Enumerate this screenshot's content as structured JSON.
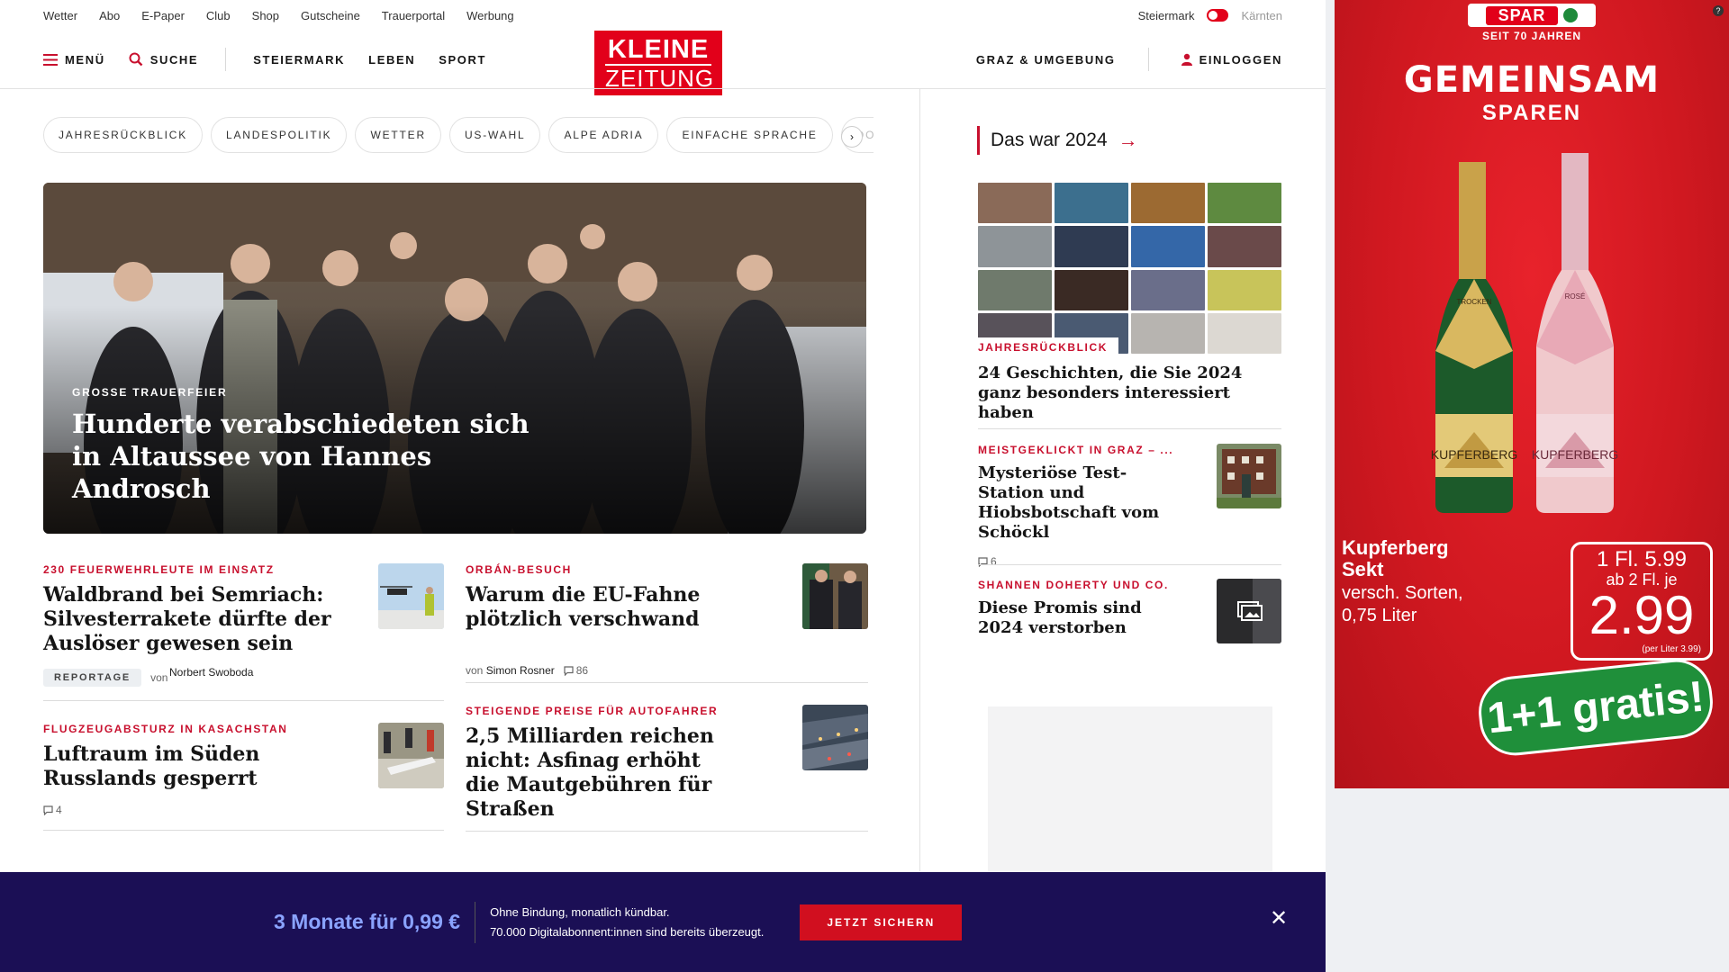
{
  "utility": {
    "links": [
      "Wetter",
      "Abo",
      "E-Paper",
      "Club",
      "Shop",
      "Gutscheine",
      "Trauerportal",
      "Werbung"
    ],
    "region_active": "Steiermark",
    "region_other": "Kärnten"
  },
  "nav": {
    "menu": "MENÜ",
    "search": "SUCHE",
    "sections": [
      "STEIERMARK",
      "LEBEN",
      "SPORT"
    ],
    "local": "GRAZ & UMGEBUNG",
    "login": "EINLOGGEN",
    "logo_line1": "KLEINE",
    "logo_line2": "ZEITUNG"
  },
  "pills": [
    "JAHRESRÜCKBLICK",
    "LANDESPOLITIK",
    "WETTER",
    "US-WAHL",
    "ALPE ADRIA",
    "EINFACHE SPRACHE",
    "DO"
  ],
  "hero": {
    "kicker": "GROSSE TRAUERFEIER",
    "title": "Hunderte verabschiedeten sich in Altaussee von Hannes Androsch"
  },
  "articles": [
    {
      "kicker": "230 FEUERWEHRLEUTE IM EINSATZ",
      "title": "Waldbrand bei Semriach: Silvesterrakete dürfte der Auslöser gewesen sein",
      "badge": "REPORTAGE",
      "by": "von",
      "author": "Norbert Swoboda"
    },
    {
      "kicker": "ORBÁN-BESUCH",
      "title": "Warum die EU-Fahne plötzlich verschwand",
      "by": "von",
      "author": "Simon Rosner",
      "comments": "86"
    },
    {
      "kicker": "FLUGZEUGABSTURZ IN KASACHSTAN",
      "title": "Luftraum im Süden Russlands gesperrt",
      "comments": "4"
    },
    {
      "kicker": "STEIGENDE PREISE FÜR AUTOFAHRER",
      "title": "2,5 Milliarden reichen nicht: Asfinag erhöht die Mautgebühren für Straßen"
    }
  ],
  "sidebar": {
    "heading": "Das war 2024",
    "feature_kicker": "JAHRESRÜCKBLICK",
    "feature_title": "24 Geschichten, die Sie 2024 ganz besonders interessiert haben",
    "items": [
      {
        "kicker": "MEISTGEKLICKT IN GRAZ – ...",
        "title": "Mysteriöse Test-Station und Hiobsbotschaft vom Schöckl",
        "comments": "6"
      },
      {
        "kicker": "SHANNEN DOHERTY UND CO.",
        "title": "Diese Promis sind 2024 verstorben"
      }
    ]
  },
  "ad": {
    "brand": "SPAR",
    "since": "SEIT 70 JAHREN",
    "headline1": "GEMEINSAM",
    "headline2": "SPAREN",
    "product": "Kupferberg Sekt",
    "desc1": "versch. Sorten,",
    "desc2": "0,75 Liter",
    "price1": "1 Fl. 5.99",
    "price2": "ab 2 Fl. je",
    "price3": "2.99",
    "price_note": "(per Liter 3.99)",
    "offer": "1+1 gratis!",
    "bottle1_label": "KUPFERBERG",
    "bottle1_sort": "TROCKEN",
    "bottle2_label": "KUPFERBERG",
    "bottle2_sort": "ROSÉ"
  },
  "promo": {
    "offer": "3 Monate für 0,99 €",
    "line1": "Ohne Bindung, monatlich kündbar.",
    "line2": "70.000 Digitalabonnent:innen sind bereits überzeugt.",
    "cta": "JETZT SICHERN",
    "close": "✕"
  },
  "colors": {
    "brand_red": "#e2001a",
    "kicker_red": "#c8102e",
    "promo_bg": "#1b0f55",
    "promo_offer": "#8aa3ff"
  }
}
